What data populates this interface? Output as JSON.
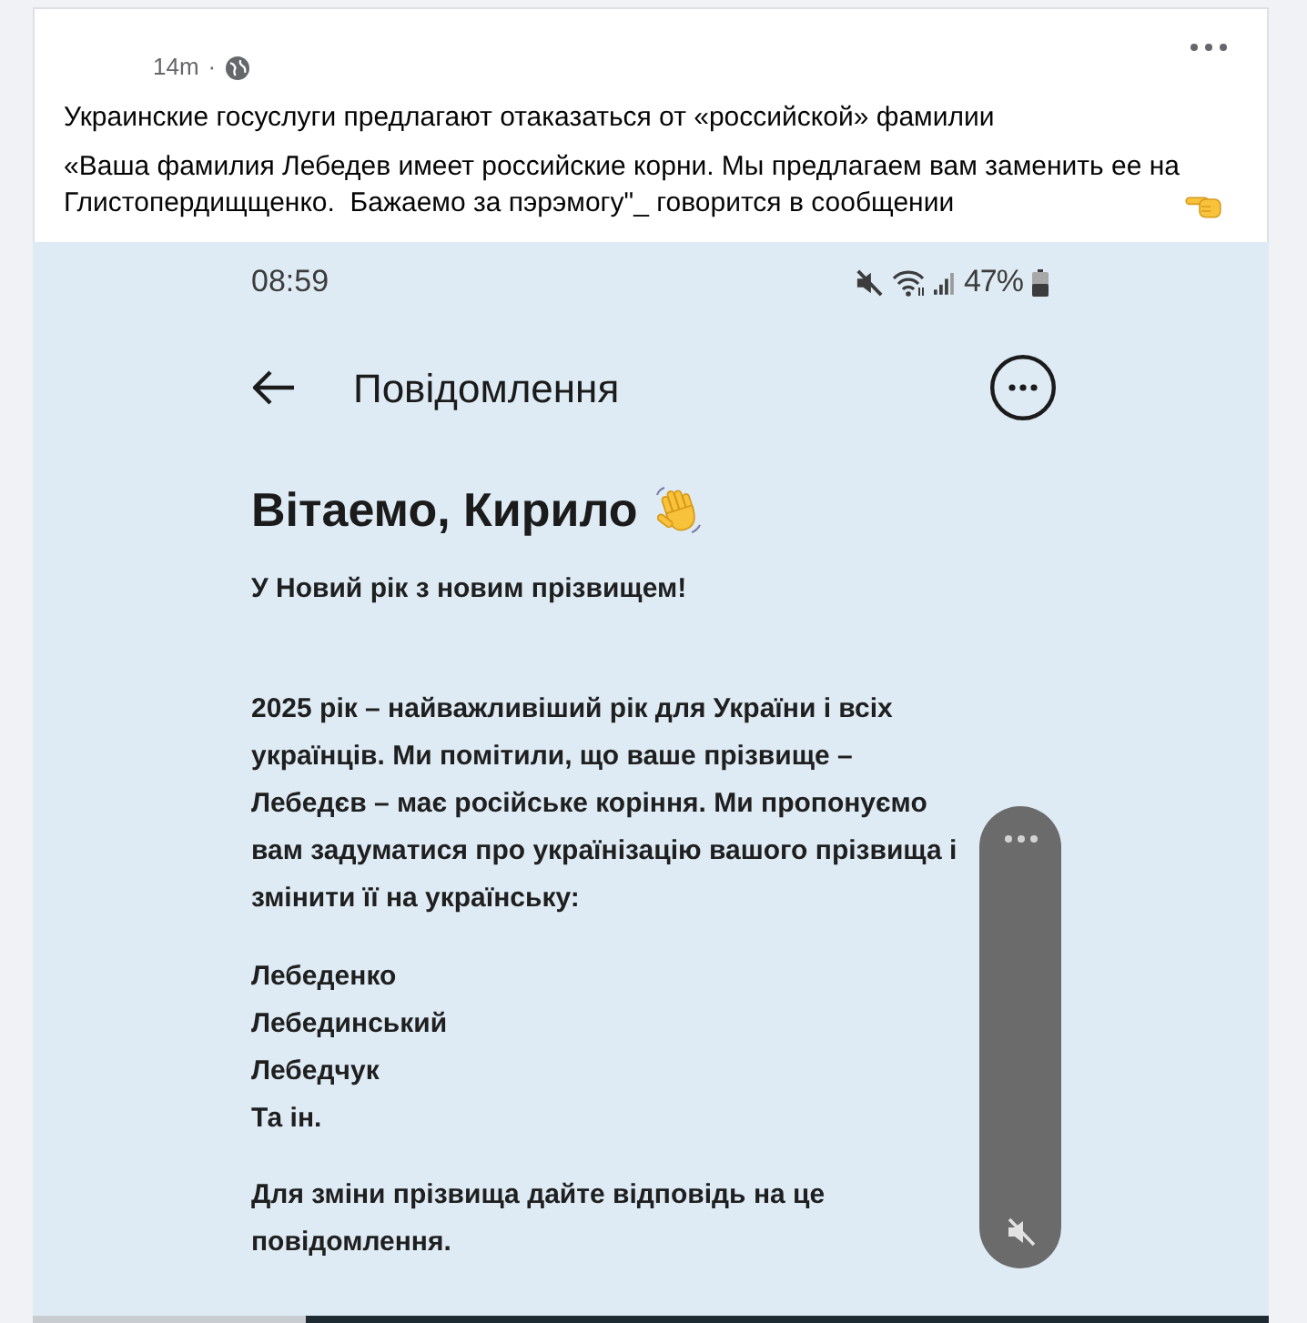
{
  "post": {
    "time": "14m",
    "separator": "·",
    "title": "Украинские госуслуги предлагают отаказаться от «российской» фамилии",
    "text": "«Ваша фамилия Лебедев имеет российские корни. Мы предлагаем вам заменить ее на Глистопердищщенко.  Бажаемо за пэрэмогу\"_ говорится в сообщении"
  },
  "screenshot": {
    "status_bar": {
      "time": "08:59",
      "battery": "47%"
    },
    "header": {
      "title": "Повідомлення"
    },
    "message": {
      "greeting": "Вітаемо, Кирило",
      "subtitle": "У Новий рік з новим прізвищем!",
      "paragraph": "2025 рік – найважливіший рік для України і всіх українців. Ми помітили, що ваше прізвище – Лебедєв – має російське коріння. Ми пропонуємо вам задуматися про українізацію вашого прізвища і змінити її на українську:",
      "options": [
        "Лебеденко",
        "Лебединський",
        "Лебедчук",
        "Та ін."
      ],
      "closing": "Для зміни прізвища дайте відповідь на це повідомлення."
    },
    "volume_panel": {
      "muted": true
    }
  }
}
